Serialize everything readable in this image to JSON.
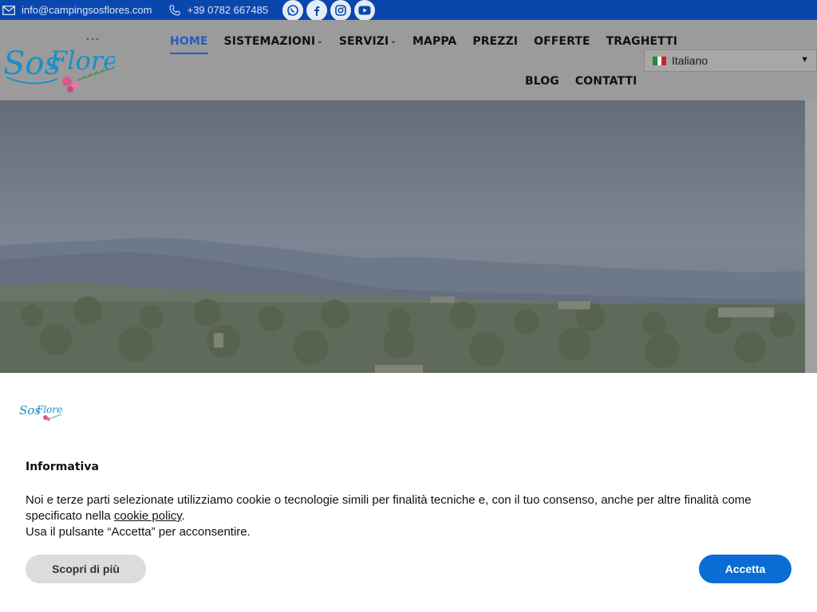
{
  "topbar": {
    "email": "info@campingsosflores.com",
    "phone": "+39 0782 667485",
    "social_icons": [
      "whatsapp-icon",
      "facebook-icon",
      "instagram-icon",
      "youtube-icon"
    ]
  },
  "header": {
    "logo_text": "SosFlores",
    "nav": [
      {
        "label": "HOME",
        "active": true
      },
      {
        "label": "SISTEMAZIONI",
        "has_dropdown": true
      },
      {
        "label": "SERVIZI",
        "has_dropdown": true
      },
      {
        "label": "MAPPA"
      },
      {
        "label": "PREZZI"
      },
      {
        "label": "OFFERTE"
      },
      {
        "label": "TRAGHETTI"
      },
      {
        "label": "BLOG"
      },
      {
        "label": "CONTATTI"
      }
    ],
    "language": {
      "selected": "Italiano",
      "flag": "italy-flag-icon"
    }
  },
  "cookie_banner": {
    "title": "Informativa",
    "text_before_link": "Noi e terze parti selezionate utilizziamo cookie o tecnologie simili per finalità tecniche e, con il tuo consenso, anche per altre finalità come specificato nella ",
    "link_label": "cookie policy",
    "text_after_link": ".",
    "line2": "Usa il pulsante “Accetta” per acconsentire.",
    "more_button": "Scopri di più",
    "accept_button": "Accetta"
  },
  "colors": {
    "topbar_bg": "#0a47ad",
    "accent": "#1f5fc5",
    "accept_button": "#0a6cd4"
  }
}
